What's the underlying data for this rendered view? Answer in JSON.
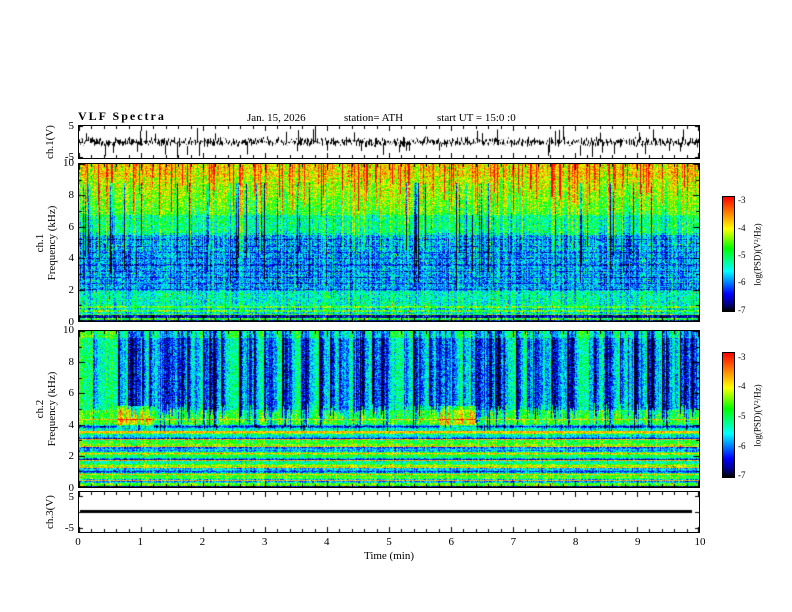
{
  "header": {
    "title": "VLF  Spectra",
    "date": "Jan. 15, 2026",
    "station": "station= ATH",
    "start_ut": "start UT =  15:0 :0"
  },
  "xaxis": {
    "label": "Time (min)",
    "range": [
      0,
      10
    ],
    "tick_labels": [
      "0",
      "1",
      "2",
      "3",
      "4",
      "5",
      "6",
      "7",
      "8",
      "9",
      "10"
    ],
    "minor_ticks_per_interval": 5
  },
  "panels": {
    "ch1wave": {
      "ylabel": "ch.1(V)",
      "ylim": [
        -5,
        5
      ],
      "ytick_labels": [
        "5",
        "-5"
      ],
      "ytick_fracs": [
        0.02,
        0.94
      ]
    },
    "spec1": {
      "ylabel_lines": [
        "ch.1",
        "Frequency (kHz)"
      ],
      "ylim": [
        0,
        10
      ],
      "ytick_labels": [
        "10",
        "8",
        "6",
        "4",
        "2",
        "0"
      ]
    },
    "spec2": {
      "ylabel_lines": [
        "ch.2",
        "Frequency (kHz)"
      ],
      "ylim": [
        0,
        10
      ],
      "ytick_labels": [
        "10",
        "8",
        "6",
        "4",
        "2",
        "0"
      ]
    },
    "ch3wave": {
      "ylabel": "ch.3(V)",
      "ylim": [
        -5,
        5
      ],
      "ytick_labels": [
        "5",
        "-5"
      ],
      "ytick_fracs": [
        0.15,
        0.88
      ]
    }
  },
  "colorbars": [
    {
      "label": "log(PSD)(V²/Hz)",
      "tick_labels": [
        "-3",
        "-4",
        "-5",
        "-6",
        "-7"
      ],
      "range": [
        -7,
        -3
      ]
    },
    {
      "label": "log(PSD)(V²/Hz)",
      "tick_labels": [
        "-3",
        "-4",
        "-5",
        "-6",
        "-7"
      ],
      "range": [
        -7,
        -3
      ]
    }
  ],
  "colormap": {
    "name": "jet-with-black-underrange",
    "stops": [
      [
        0.0,
        "#000000"
      ],
      [
        0.06,
        "#000085"
      ],
      [
        0.15,
        "#0000ff"
      ],
      [
        0.35,
        "#00ffff"
      ],
      [
        0.55,
        "#00ff00"
      ],
      [
        0.72,
        "#ffff00"
      ],
      [
        0.86,
        "#ff8000"
      ],
      [
        1.0,
        "#ff0000"
      ]
    ]
  },
  "chart_data": [
    {
      "type": "line",
      "name": "ch1_waveform",
      "ylabel": "ch.1(V)",
      "ylim": [
        -5,
        5
      ],
      "xlim": [
        0,
        10
      ],
      "yticks": [
        5,
        -5
      ],
      "description": "Dense broadband noise waveform centered on 0 V, typical envelope about ±1.5 V, with frequent impulsive spikes reaching up to ±5 V throughout the entire 10-minute record."
    },
    {
      "type": "heatmap",
      "name": "ch1_spectrogram",
      "xlabel": "Time (min)",
      "ylabel": "Frequency (kHz)",
      "xlim": [
        0,
        10
      ],
      "ylim": [
        0,
        10
      ],
      "zlabel": "log(PSD)(V²/Hz)",
      "zlim": [
        -7,
        -3
      ],
      "yticks": [
        0,
        2,
        4,
        6,
        8,
        10
      ],
      "description": "VLF spectrogram: strong power (-3 to -4, yellow/orange/red) above ~9 kHz with many narrow red vertical impulse streaks descending from the top; yellow-green power 7-9 kHz; green around 6-7 kHz; low power (-6 to -7, blue/navy) from 2-6 kHz crossed by dark vertical sferic streaks and faint horizontal interference lines; cyan/green/yellow banded rows 0.4-2 kHz; a dark row near 0.3 kHz and a near-black strip at the 0 kHz edge."
    },
    {
      "type": "heatmap",
      "name": "ch2_spectrogram",
      "xlabel": "Time (min)",
      "ylabel": "Frequency (kHz)",
      "xlim": [
        0,
        10
      ],
      "ylim": [
        0,
        10
      ],
      "zlabel": "log(PSD)(V²/Hz)",
      "zlim": [
        -7,
        -3
      ],
      "yticks": [
        0,
        2,
        4,
        6,
        8,
        10
      ],
      "description": "Green mid-level power (~-5) above ~5 kHz interrupted by many wide dark-blue/navy vertical dropout streaks; continuous yellow-green band near 4-5 kHz with a few bright red/orange blobs (near t≈0.9 and t≈6 min); below 4 kHz strong horizontal line structure: narrowband red/orange/yellow lines near 4.35, 3.55, 3.1, 2.65, 2.2, 1.75, 1.3, 0.85 and 0.45 kHz over a cyan/green/blue banded background; near-black strip at the 0 kHz edge."
    },
    {
      "type": "line",
      "name": "ch3_waveform",
      "ylabel": "ch.3(V)",
      "ylim": [
        -5,
        5
      ],
      "xlim": [
        0,
        10
      ],
      "yticks": [
        5,
        -5
      ],
      "description": "Flat thick black line at 0 V for the whole record (dead/unused channel)."
    }
  ]
}
